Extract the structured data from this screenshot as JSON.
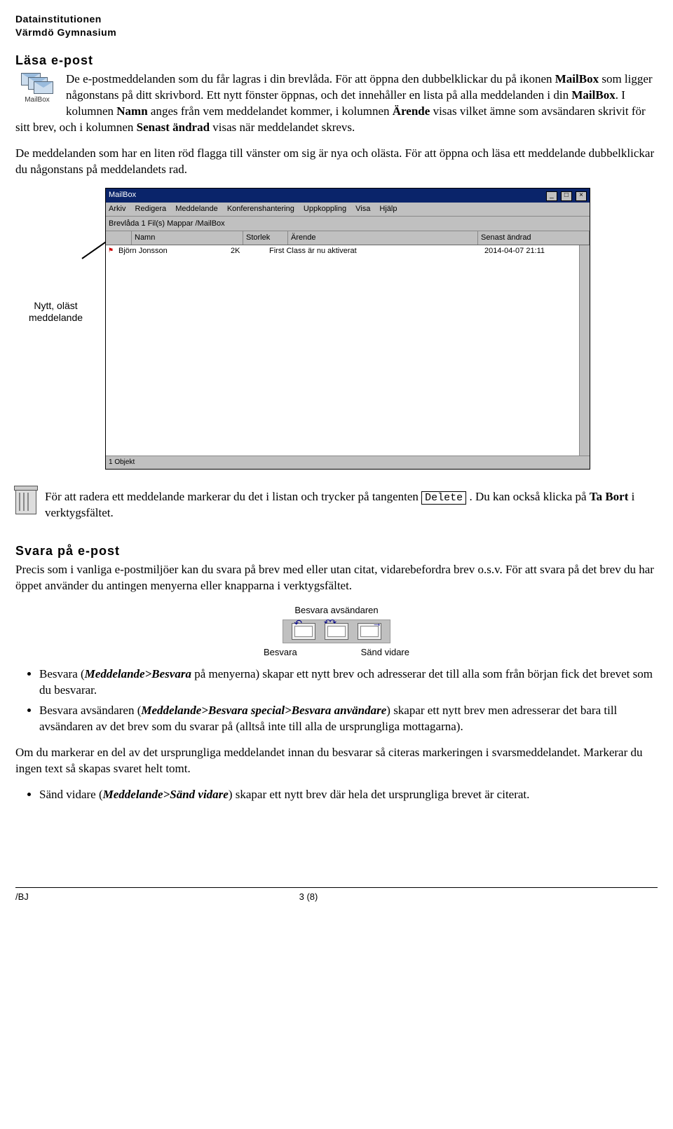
{
  "header": {
    "line1": "Datainstitutionen",
    "line2": "Värmdö Gymnasium"
  },
  "sect1_title": "Läsa e-post",
  "mailbox_icon_label": "MailBox",
  "p1_a": "De e-postmeddelanden som du får lagras i din brevlåda. För att öppna den dubbelklickar du på ikonen ",
  "p1_b": "MailBox",
  "p1_c": " som ligger någonstans på ditt skrivbord. Ett nytt fönster öppnas, och det innehåller en lista på alla meddelanden i din ",
  "p1_d": "MailBox",
  "p1_e": ". I kolumnen ",
  "p1_f": "Namn",
  "p1_g": " anges från vem meddelandet kommer, i kolumnen ",
  "p1_h": "Ärende",
  "p1_i": " visas vilket ämne som avsändaren skrivit för sitt brev, och i kolumnen ",
  "p1_j": "Senast ändrad",
  "p1_k": " visas när meddelandet skrevs.",
  "p2": "De meddelanden som har en liten röd flagga till vänster om sig är nya och olästa. För att öppna och läsa ett meddelande dubbelklickar du någonstans på meddelandets rad.",
  "arrow_label": "Nytt, oläst meddelande",
  "window": {
    "title": "MailBox",
    "menu": [
      "Arkiv",
      "Redigera",
      "Meddelande",
      "Konferenshantering",
      "Uppkoppling",
      "Visa",
      "Hjälp"
    ],
    "toolbar_left": "Brevlåda   1 Fil(s) Mappar  /MailBox",
    "toolbar_right": "",
    "cols": {
      "c2": "Namn",
      "c3": "Storlek",
      "c4": "Ärende",
      "c5": "Senast ändrad"
    },
    "row": {
      "name": "Björn Jonsson",
      "size": "2K",
      "subj": "First Class är nu aktiverat",
      "date": "2014-04-07 21:11"
    },
    "status": "1 Objekt"
  },
  "p3_a": "För att radera ett meddelande markerar du det i listan och trycker på tangenten ",
  "p3_key": "Delete",
  "p3_b": " . Du kan också klicka på ",
  "p3_c": "Ta Bort",
  "p3_d": " i verktygsfältet.",
  "sect2_title": "Svara på e-post",
  "p4": "Precis som i vanliga e-postmiljöer kan du svara på brev med eller utan citat, vidarebefordra brev o.s.v. För att svara på det brev du har öppet använder du antingen menyerna eller knapparna i verktygsfältet.",
  "reply_fig": {
    "top": "Besvara avsändaren",
    "left": "Besvara",
    "right": "Sänd vidare"
  },
  "b1_a": "Besvara (",
  "b1_b": "Meddelande>Besvara",
  "b1_c": " på menyerna) skapar ett nytt brev och adresserar det till alla som från början fick det brevet som du besvarar.",
  "b2_a": "Besvara avsändaren (",
  "b2_b": "Meddelande>Besvara special>Besvara användare",
  "b2_c": ") skapar ett nytt brev men adresserar det bara till avsändaren av det brev som du svarar på (alltså inte till alla de ursprungliga mottagarna).",
  "p5": "Om du markerar en del av det ursprungliga meddelandet innan du besvarar så citeras markeringen i svarsmeddelandet. Markerar du ingen text så skapas svaret helt tomt.",
  "b3_a": "Sänd vidare (",
  "b3_b": "Meddelande>Sänd vidare",
  "b3_c": ") skapar ett nytt brev där hela det ursprungliga brevet är citerat.",
  "footer": {
    "bj": "/BJ",
    "page": "3 (8)"
  }
}
